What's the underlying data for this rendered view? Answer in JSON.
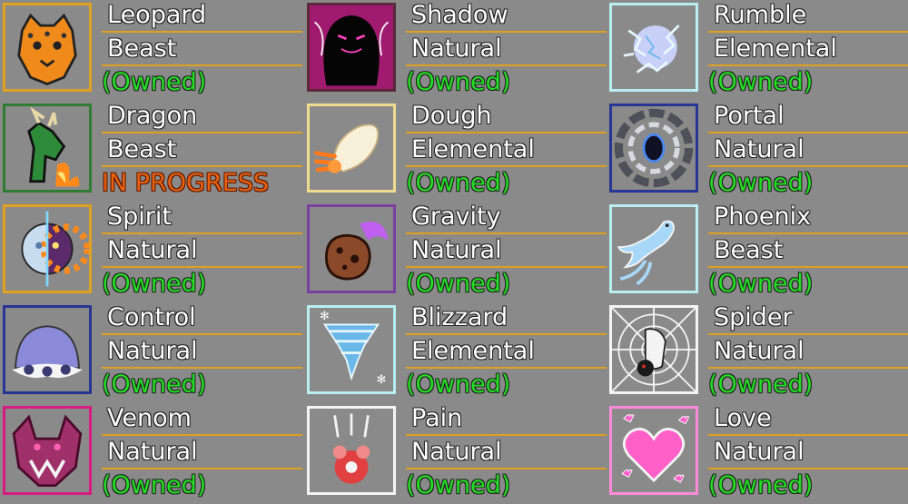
{
  "columns": [
    {
      "entries": [
        {
          "name": "Leopard",
          "type": "Beast",
          "status": "(Owned)",
          "status_kind": "owned",
          "icon": "leopard-icon",
          "border": "#e0a020"
        },
        {
          "name": "Dragon",
          "type": "Beast",
          "status": "IN PROGRESS",
          "status_kind": "progress",
          "icon": "dragon-icon",
          "border": "#2e7d32"
        },
        {
          "name": "Spirit",
          "type": "Natural",
          "status": "(Owned)",
          "status_kind": "owned",
          "icon": "spirit-icon",
          "border": "#e0a020"
        },
        {
          "name": "Control",
          "type": "Natural",
          "status": "(Owned)",
          "status_kind": "owned",
          "icon": "control-icon",
          "border": "#283593"
        },
        {
          "name": "Venom",
          "type": "Natural",
          "status": "(Owned)",
          "status_kind": "owned",
          "icon": "venom-icon",
          "border": "#d81b80"
        }
      ]
    },
    {
      "entries": [
        {
          "name": "Shadow",
          "type": "Natural",
          "status": "(Owned)",
          "status_kind": "owned",
          "icon": "shadow-icon",
          "border": "#5a2a3a"
        },
        {
          "name": "Dough",
          "type": "Elemental",
          "status": "(Owned)",
          "status_kind": "owned",
          "icon": "dough-icon",
          "border": "#f0dc90"
        },
        {
          "name": "Gravity",
          "type": "Natural",
          "status": "(Owned)",
          "status_kind": "owned",
          "icon": "gravity-icon",
          "border": "#7b3fa0"
        },
        {
          "name": "Blizzard",
          "type": "Elemental",
          "status": "(Owned)",
          "status_kind": "owned",
          "icon": "blizzard-icon",
          "border": "#b8eef0"
        },
        {
          "name": "Pain",
          "type": "Natural",
          "status": "(Owned)",
          "status_kind": "owned",
          "icon": "pain-icon",
          "border": "#f4f4f4"
        }
      ]
    },
    {
      "entries": [
        {
          "name": "Rumble",
          "type": "Elemental",
          "status": "(Owned)",
          "status_kind": "owned",
          "icon": "lightning-icon",
          "border": "#b8eef0"
        },
        {
          "name": "Portal",
          "type": "Natural",
          "status": "(Owned)",
          "status_kind": "owned",
          "icon": "portal-icon",
          "border": "#283593"
        },
        {
          "name": "Phoenix",
          "type": "Beast",
          "status": "(Owned)",
          "status_kind": "owned",
          "icon": "phoenix-icon",
          "border": "#b8eef0"
        },
        {
          "name": "Spider",
          "type": "Natural",
          "status": "(Owned)",
          "status_kind": "owned",
          "icon": "spider-icon",
          "border": "#f4f4f4"
        },
        {
          "name": "Love",
          "type": "Natural",
          "status": "(Owned)",
          "status_kind": "owned",
          "icon": "heart-icon",
          "border": "#ff8ad8"
        }
      ]
    }
  ]
}
